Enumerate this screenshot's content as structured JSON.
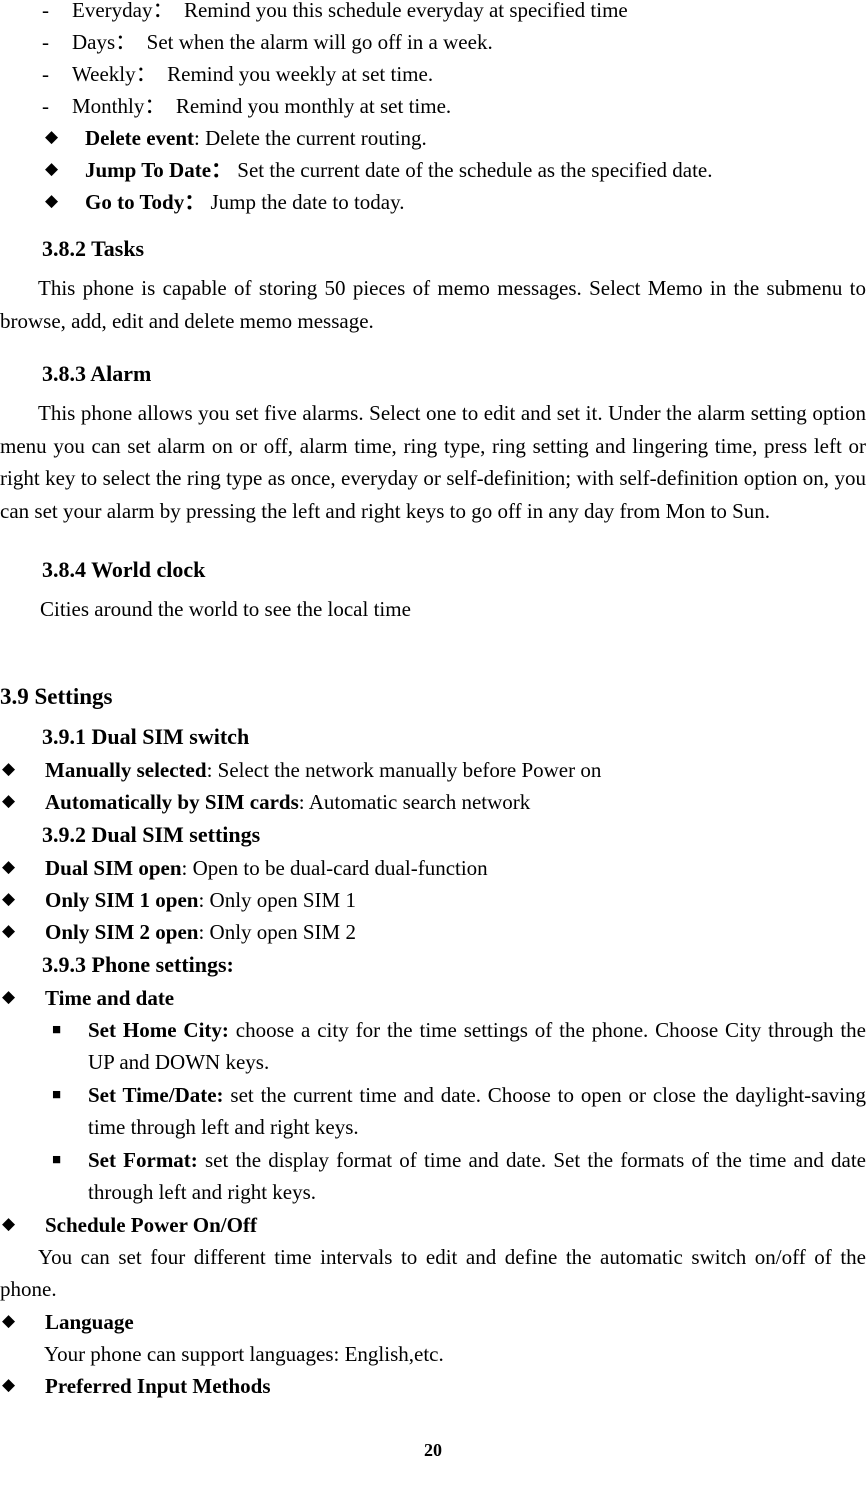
{
  "document": {
    "page_number": "20",
    "bullet_diamond": "◆",
    "bullet_square": "■",
    "bullet_dash": "-"
  },
  "schedule_options": {
    "items": [
      {
        "term": "Everyday：",
        "desc": "Remind you this schedule everyday at specified time"
      },
      {
        "term": "Days：",
        "desc": "Set when the alarm will go off in a week."
      },
      {
        "term": "Weekly：",
        "desc": "Remind you weekly at set time."
      },
      {
        "term": "Monthly：",
        "desc": "Remind you monthly at set time."
      }
    ],
    "actions": [
      {
        "term": "Delete event",
        "sep": ": ",
        "desc": "Delete the current routing."
      },
      {
        "term": "Jump To Date",
        "sep": "：",
        "desc": "Set the current date of the schedule as the specified date."
      },
      {
        "term": "Go to Tody",
        "sep": "：",
        "desc": "Jump the date to today."
      }
    ]
  },
  "tasks": {
    "heading": "3.8.2 Tasks",
    "body": "This phone is capable of storing 50 pieces of memo messages. Select Memo in the submenu to browse, add, edit and delete memo message."
  },
  "alarm": {
    "heading": "3.8.3 Alarm",
    "body": "This phone allows you set five alarms. Select one to edit and set it. Under the alarm setting option menu you can set alarm on or off, alarm time, ring type, ring setting and lingering time, press left or right key to select the ring type as once, everyday or self-definition; with self-definition option on, you can set your alarm by pressing the left and right keys to go off in any day from Mon to Sun."
  },
  "world_clock": {
    "heading": "3.8.4 World clock",
    "body": "Cities around the world to see the local time"
  },
  "settings": {
    "heading": "3.9 Settings",
    "dual_sim_switch": {
      "heading": "3.9.1 Dual SIM switch",
      "items": [
        {
          "term": "Manually selected",
          "sep": ": ",
          "desc": "Select the network manually before Power on"
        },
        {
          "term": "Automatically by SIM cards",
          "sep": ": ",
          "desc": "Automatic search network"
        }
      ]
    },
    "dual_sim_settings": {
      "heading": "3.9.2 Dual SIM settings",
      "items": [
        {
          "term": "Dual SIM open",
          "sep": ": ",
          "desc": "Open to be dual-card dual-function"
        },
        {
          "term": "Only SIM 1 open",
          "sep": ": ",
          "desc": "Only open SIM 1"
        },
        {
          "term": "Only SIM 2 open",
          "sep": ": ",
          "desc": "Only open SIM 2"
        }
      ]
    },
    "phone_settings": {
      "heading": "3.9.3 Phone settings:",
      "time_and_date": {
        "label": "Time and date",
        "items": [
          {
            "term": "Set Home City:",
            "desc": " choose a city for the time settings of the phone. Choose City through the UP and DOWN keys."
          },
          {
            "term": "Set Time/Date:",
            "desc": " set the current time and date. Choose to open or close the daylight-saving time through left and right keys."
          },
          {
            "term": "Set Format:",
            "desc": " set the display format of time and date. Set the formats of the time and date through left and right keys."
          }
        ]
      },
      "schedule_power": {
        "label": "Schedule Power On/Off",
        "body": "You can set four different time intervals to edit and define the automatic switch on/off of the phone."
      },
      "language": {
        "label": "Language",
        "body": "Your phone can support languages: English,etc."
      },
      "preferred_input": {
        "label": "Preferred Input Methods"
      }
    }
  }
}
